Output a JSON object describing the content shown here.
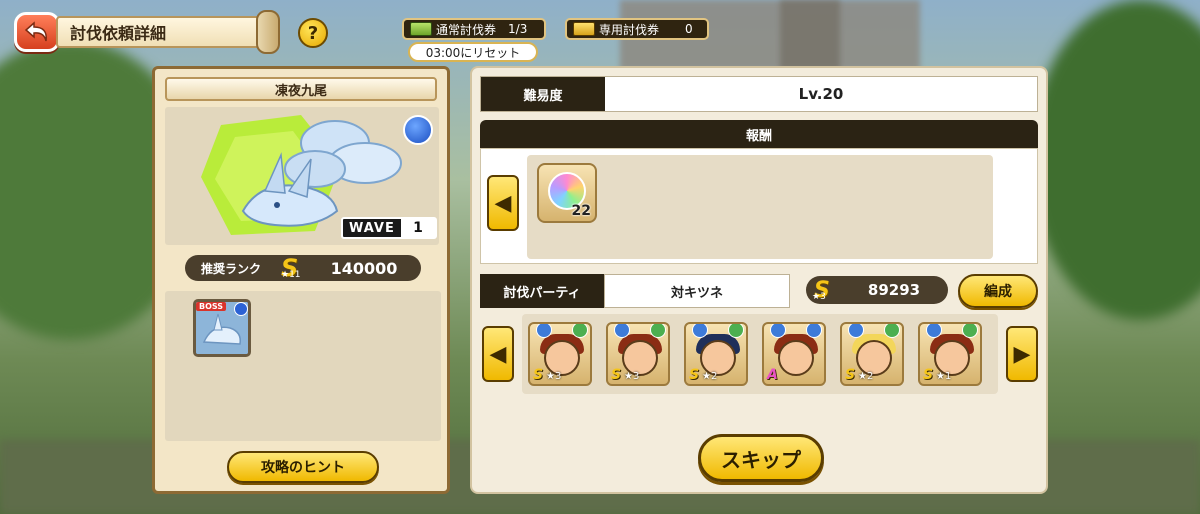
{
  "header": {
    "title": "討伐依頼詳細",
    "help_label": "?",
    "back_icon": "back-arrow-icon"
  },
  "tickets": {
    "normal_label": "通常討伐券",
    "normal_value": "1/3",
    "dedicated_label": "専用討伐券",
    "dedicated_value": "0",
    "reset_text": "03:00にリセット"
  },
  "boss": {
    "name": "凍夜九尾",
    "wave_label": "WAVE",
    "wave_value": "1",
    "element_icon": "water-element-icon",
    "recommended_rank_label": "推奨ランク",
    "recommended_rank_grade": "S",
    "recommended_rank_stars": "★11",
    "recommended_rank_value": "140000",
    "enemy_badge": "BOSS",
    "hint_button": "攻略のヒント"
  },
  "details": {
    "difficulty_label": "難易度",
    "difficulty_value": "Lv.20",
    "reward_header": "報酬",
    "reward_count": "22",
    "party_label": "討伐パーティ",
    "party_name": "対キツネ",
    "party_rank_grade": "S",
    "party_rank_stars": "★3",
    "party_power": "89293",
    "edit_button": "編成",
    "skip_button": "スキップ",
    "members": [
      {
        "rank": "S",
        "stars": "★3",
        "hair": "#8b2d14",
        "badge1": "#3d7bd9",
        "badge2": "#4caf50"
      },
      {
        "rank": "S",
        "stars": "★3",
        "hair": "#8b2d14",
        "badge1": "#3d7bd9",
        "badge2": "#4caf50"
      },
      {
        "rank": "S",
        "stars": "★2",
        "hair": "#1f2f5a",
        "badge1": "#3d7bd9",
        "badge2": "#4caf50"
      },
      {
        "rank": "A",
        "stars": "",
        "hair": "#8b2d14",
        "badge1": "#3d7bd9",
        "badge2": "#3d7bd9"
      },
      {
        "rank": "S",
        "stars": "★2",
        "hair": "#f3d65a",
        "badge1": "#3d7bd9",
        "badge2": "#4caf50"
      },
      {
        "rank": "S",
        "stars": "★1",
        "hair": "#8b2d14",
        "badge1": "#3d7bd9",
        "badge2": "#4caf50"
      }
    ]
  },
  "colors": {
    "panel_dark": "#2b2314",
    "button_yellow": "#f0b900",
    "rank_gold": "#f5c518"
  }
}
